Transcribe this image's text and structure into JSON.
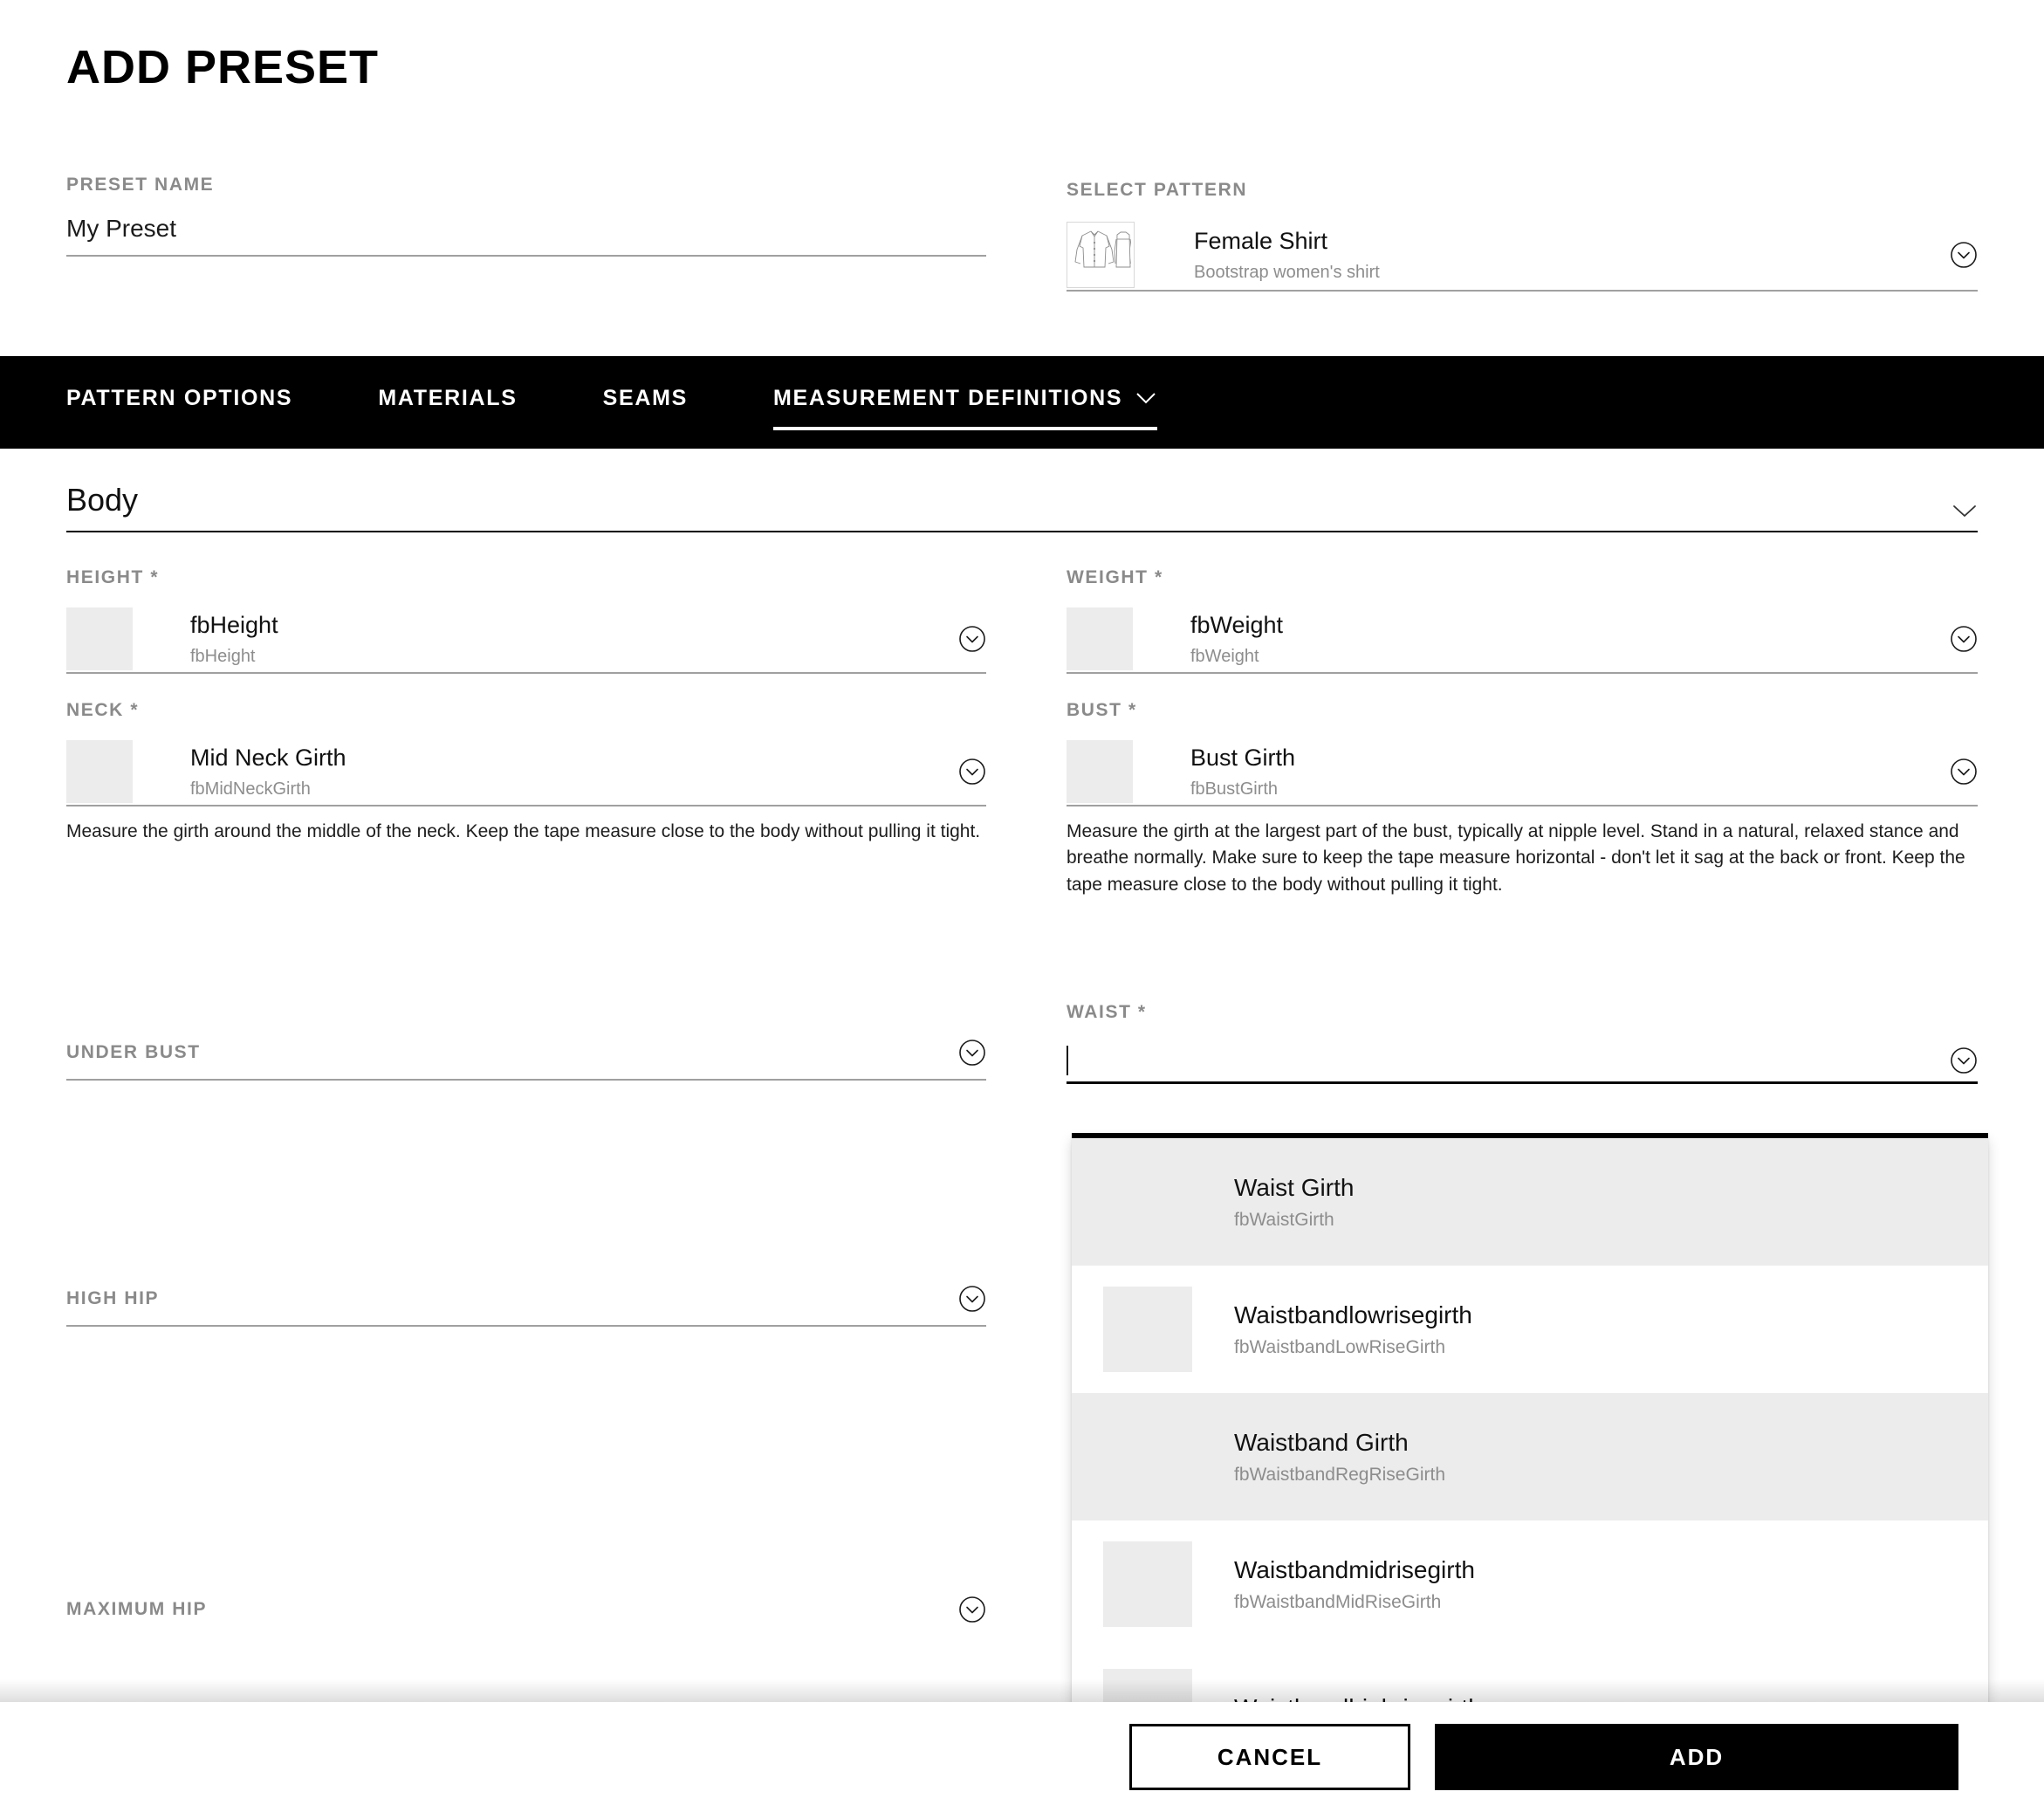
{
  "header": {
    "title": "ADD PRESET",
    "preset_name": {
      "label": "PRESET NAME",
      "value": "My Preset",
      "placeholder": ""
    },
    "select_pattern": {
      "label": "SELECT PATTERN",
      "title": "Female Shirt",
      "subtitle": "Bootstrap women's shirt"
    }
  },
  "tabs": [
    {
      "label": "PATTERN OPTIONS",
      "active": false,
      "caret": ""
    },
    {
      "label": "MATERIALS",
      "active": false,
      "caret": ""
    },
    {
      "label": "SEAMS",
      "active": false,
      "caret": ""
    },
    {
      "label": "MEASUREMENT DEFINITIONS",
      "active": true,
      "caret": "⌄"
    }
  ],
  "section": {
    "title": "Body"
  },
  "fields": {
    "height": {
      "label": "HEIGHT *",
      "title": "fbHeight",
      "subtitle": "fbHeight",
      "hint": ""
    },
    "weight": {
      "label": "WEIGHT *",
      "title": "fbWeight",
      "subtitle": "fbWeight",
      "hint": ""
    },
    "neck": {
      "label": "NECK *",
      "title": "Mid Neck Girth",
      "subtitle": "fbMidNeckGirth",
      "hint": "Measure the girth around the middle of the neck. Keep the tape measure close to the body without pulling it tight."
    },
    "bust": {
      "label": "BUST *",
      "title": "Bust Girth",
      "subtitle": "fbBustGirth",
      "hint": "Measure the girth at the largest part of the bust, typically at nipple level. Stand in a natural, relaxed stance and breathe normally. Make sure to keep the tape measure horizontal - don't let it sag at the back or front. Keep the tape measure close to the body without pulling it tight."
    },
    "under_bust": {
      "label": "UNDER BUST",
      "value": ""
    },
    "high_hip": {
      "label": "HIGH HIP",
      "value": ""
    },
    "maximum_hip": {
      "label": "MAXIMUM HIP",
      "value": ""
    },
    "waist": {
      "label": "WAIST *",
      "value": "",
      "placeholder": ""
    }
  },
  "waist_dropdown": {
    "options": [
      {
        "title": "Waist Girth",
        "subtitle": "fbWaistGirth",
        "highlighted": true,
        "has_thumb": false
      },
      {
        "title": "Waistbandlowrisegirth",
        "subtitle": "fbWaistbandLowRiseGirth",
        "highlighted": false,
        "has_thumb": true
      },
      {
        "title": "Waistband Girth",
        "subtitle": "fbWaistbandRegRiseGirth",
        "highlighted": true,
        "has_thumb": false
      },
      {
        "title": "Waistbandmidrisegirth",
        "subtitle": "fbWaistbandMidRiseGirth",
        "highlighted": false,
        "has_thumb": true
      },
      {
        "title": "Waistbandhighrisegirth",
        "subtitle": "",
        "highlighted": false,
        "has_thumb": true
      }
    ]
  },
  "footer": {
    "cancel_label": "CANCEL",
    "add_label": "ADD"
  },
  "colors": {
    "accent": "#000000",
    "muted_label": "#8a8a8a",
    "rule": "#a0a0a0",
    "thumb_placeholder": "#ececec",
    "highlight_row": "#ececec"
  }
}
